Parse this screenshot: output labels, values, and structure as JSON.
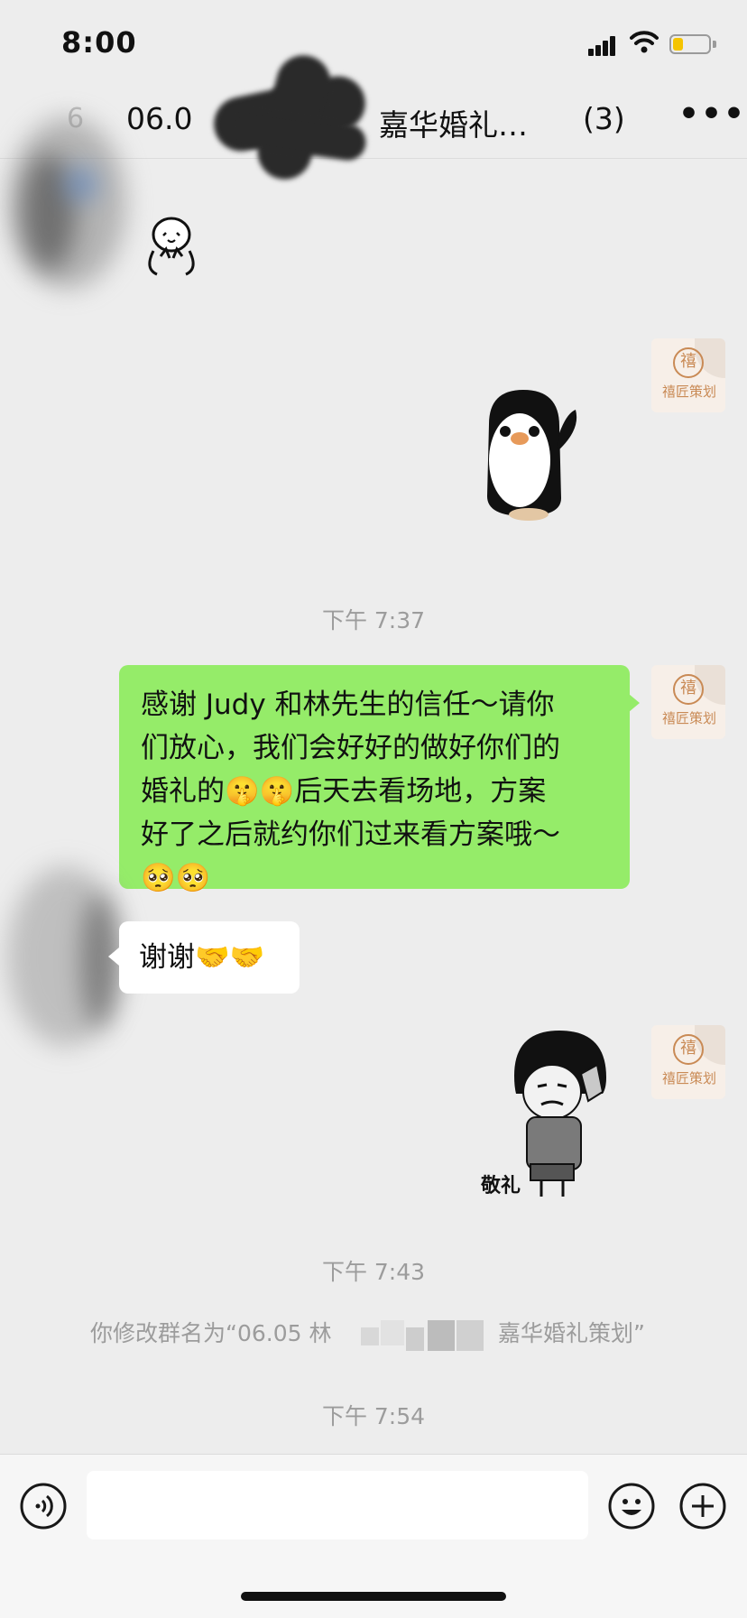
{
  "status_bar": {
    "time": "8:00",
    "battery_level": 0.3
  },
  "nav": {
    "back_fragment": "6",
    "title_left": "06.0",
    "title_right": "嘉华婚礼…",
    "member_count": "(3)",
    "more_glyph": "•••"
  },
  "messages": [
    {
      "type": "sticker",
      "side": "left",
      "name": "shy-sticker"
    },
    {
      "type": "sticker",
      "side": "right",
      "name": "penguin-sticker"
    },
    {
      "type": "timestamp",
      "text": "下午 7:37"
    },
    {
      "type": "text",
      "side": "right",
      "line1": "感谢 Judy 和林先生的信任～请你",
      "line2": "们放心，我们会好好的做好你们的",
      "line3": "婚礼的🤫🤫后天去看场地，方案",
      "line4": "好了之后就约你们过来看方案哦～",
      "line5": "🥺🥺"
    },
    {
      "type": "text",
      "side": "left",
      "text": "谢谢🤝🤝"
    },
    {
      "type": "sticker",
      "side": "right",
      "name": "salute-sticker",
      "caption": "敬礼"
    },
    {
      "type": "timestamp",
      "text": "下午 7:43"
    },
    {
      "type": "system",
      "left": "你修改群名为“06.05 林",
      "right": "嘉华婚礼策划”"
    },
    {
      "type": "timestamp",
      "text": "下午 7:54"
    }
  ],
  "avatar_brand": {
    "logo_char": "禧",
    "text": "禧匠策划"
  },
  "input_bar": {
    "voice_icon": "voice-icon",
    "emoji_icon": "emoji-icon",
    "add_icon": "plus-icon"
  },
  "colors": {
    "background": "#ededed",
    "sent_bubble": "#95ec69",
    "received_bubble": "#ffffff",
    "brand": "#c98a55"
  }
}
